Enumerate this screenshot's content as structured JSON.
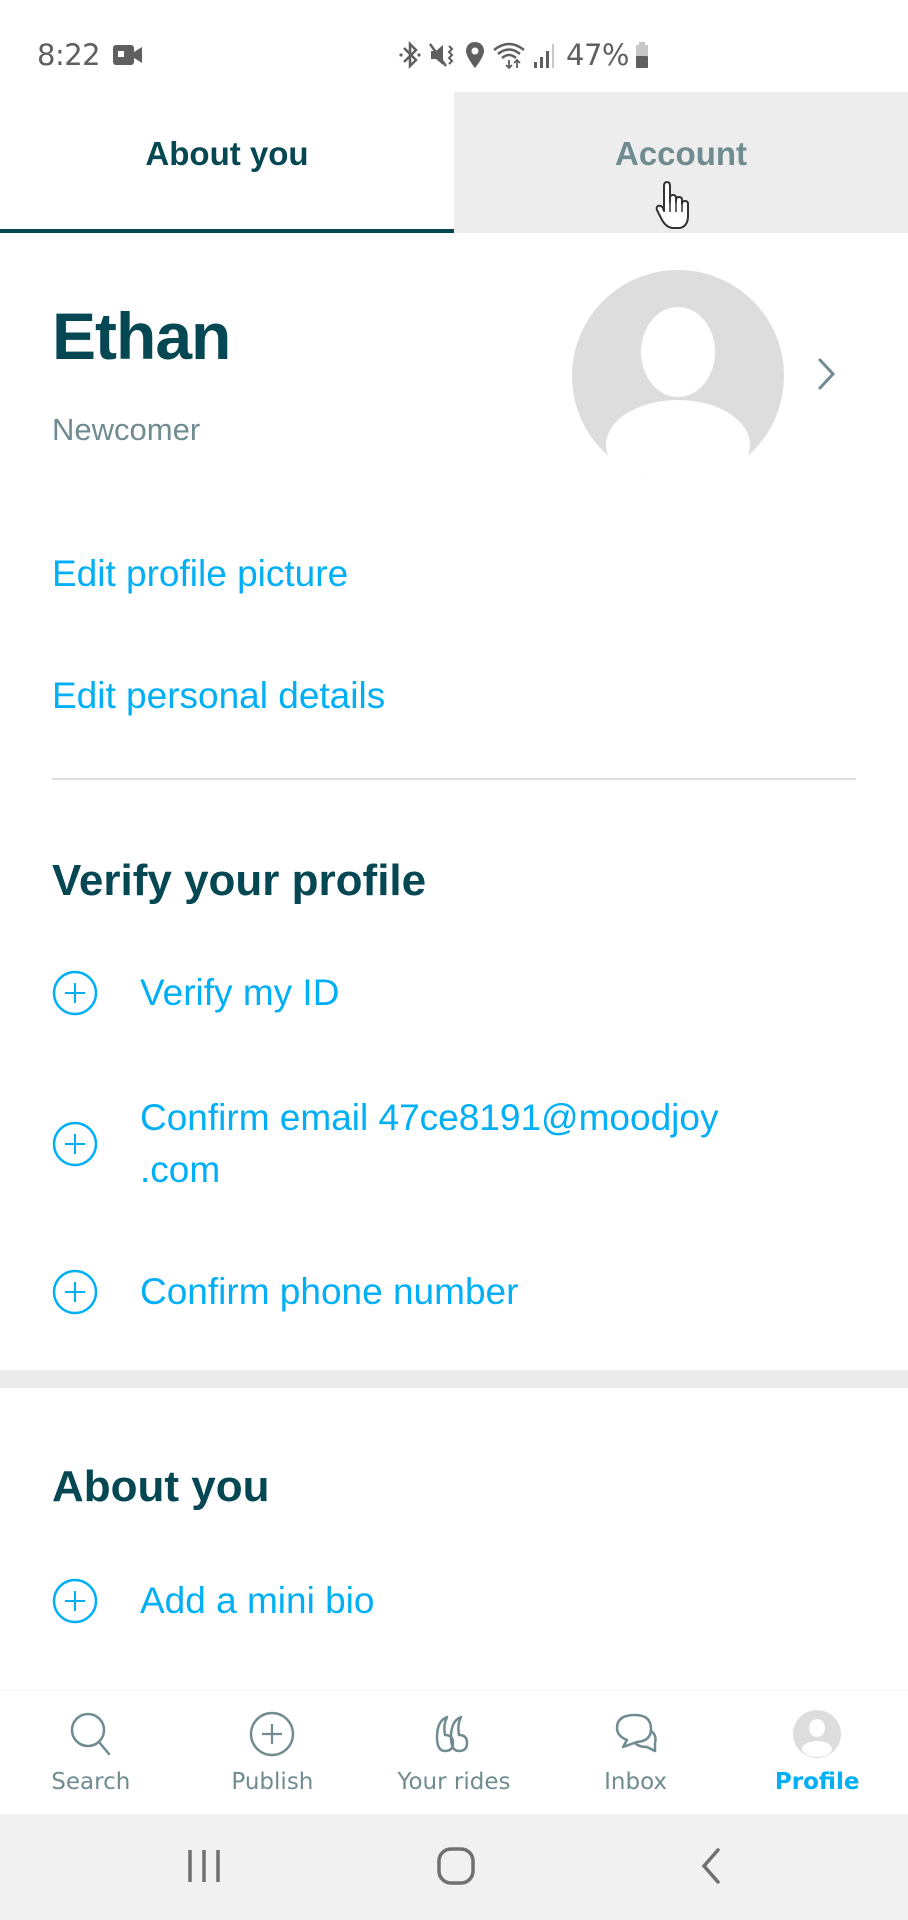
{
  "status_bar": {
    "time": "8:22",
    "battery": "47%",
    "icons": [
      "video-camera-icon",
      "bluetooth-icon",
      "mute-vibrate-icon",
      "location-icon",
      "wifi-icon",
      "signal-icon",
      "battery-icon"
    ]
  },
  "tabs": [
    {
      "label": "About you",
      "active": true
    },
    {
      "label": "Account",
      "active": false
    }
  ],
  "profile": {
    "name": "Ethan",
    "level": "Newcomer"
  },
  "links": {
    "edit_picture": "Edit profile picture",
    "edit_details": "Edit personal details"
  },
  "verify": {
    "title": "Verify your profile",
    "items": [
      {
        "label": "Verify my ID"
      },
      {
        "label": "Confirm email 47ce8191@moodjoy .com"
      },
      {
        "label": "Confirm phone number"
      }
    ]
  },
  "about": {
    "title": "About you",
    "items": [
      {
        "label": "Add a mini bio"
      }
    ]
  },
  "bottom_nav": {
    "items": [
      {
        "label": "Search",
        "icon": "search-icon",
        "active": false
      },
      {
        "label": "Publish",
        "icon": "plus-circle-icon",
        "active": false
      },
      {
        "label": "Your rides",
        "icon": "rides-icon",
        "active": false
      },
      {
        "label": "Inbox",
        "icon": "chat-bubbles-icon",
        "active": false
      },
      {
        "label": "Profile",
        "icon": "profile-avatar-icon",
        "active": true
      }
    ]
  },
  "colors": {
    "primary_dark": "#054752",
    "accent_blue": "#00aff5",
    "muted": "#708c91",
    "tab_inactive_bg": "#ededed"
  }
}
